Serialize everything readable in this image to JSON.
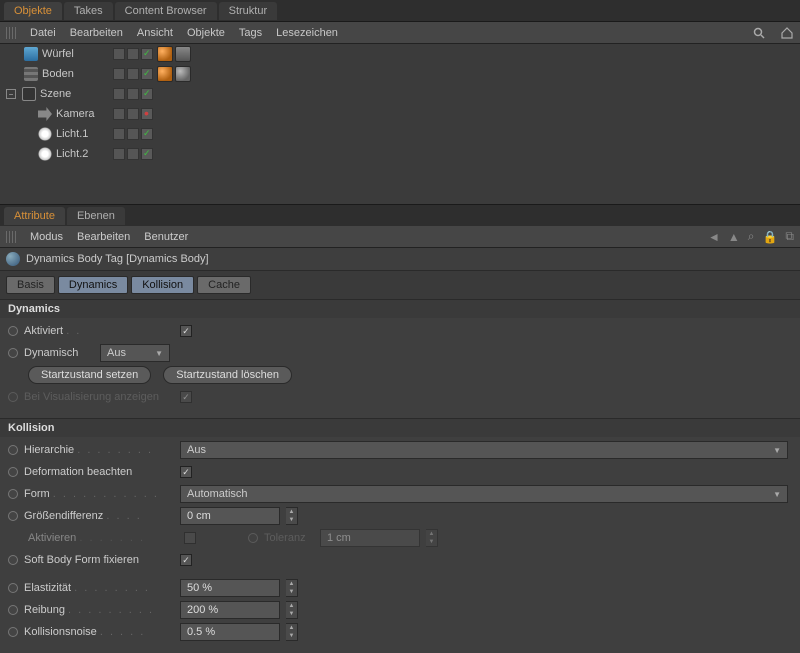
{
  "topTabs": {
    "objekte": "Objekte",
    "takes": "Takes",
    "content": "Content Browser",
    "struktur": "Struktur"
  },
  "omMenu": {
    "datei": "Datei",
    "bearbeiten": "Bearbeiten",
    "ansicht": "Ansicht",
    "objekte": "Objekte",
    "tags": "Tags",
    "lesezeichen": "Lesezeichen"
  },
  "objects": {
    "wuerfel": "Würfel",
    "boden": "Boden",
    "szene": "Szene",
    "kamera": "Kamera",
    "licht1": "Licht.1",
    "licht2": "Licht.2"
  },
  "attrTabs": {
    "attribute": "Attribute",
    "ebenen": "Ebenen"
  },
  "attrMenu": {
    "modus": "Modus",
    "bearbeiten": "Bearbeiten",
    "benutzer": "Benutzer"
  },
  "attrTitle": "Dynamics Body Tag [Dynamics Body]",
  "subtabs": {
    "basis": "Basis",
    "dynamics": "Dynamics",
    "kollision": "Kollision",
    "cache": "Cache"
  },
  "dyn": {
    "section": "Dynamics",
    "aktiviert": "Aktiviert",
    "dynamisch": "Dynamisch",
    "dynVal": "Aus",
    "btnSet": "Startzustand setzen",
    "btnClear": "Startzustand löschen",
    "vis": "Bei Visualisierung anzeigen"
  },
  "kol": {
    "section": "Kollision",
    "hierarchie": "Hierarchie",
    "hierVal": "Aus",
    "deform": "Deformation beachten",
    "form": "Form",
    "formVal": "Automatisch",
    "groesse": "Größendifferenz",
    "groesseVal": "0 cm",
    "aktivieren": "Aktivieren",
    "toleranz": "Toleranz",
    "tolVal": "1 cm",
    "softbody": "Soft Body Form fixieren",
    "elast": "Elastizität",
    "elastVal": "50 %",
    "reibung": "Reibung",
    "reibVal": "200 %",
    "noise": "Kollisionsnoise",
    "noiseVal": "0.5 %"
  }
}
